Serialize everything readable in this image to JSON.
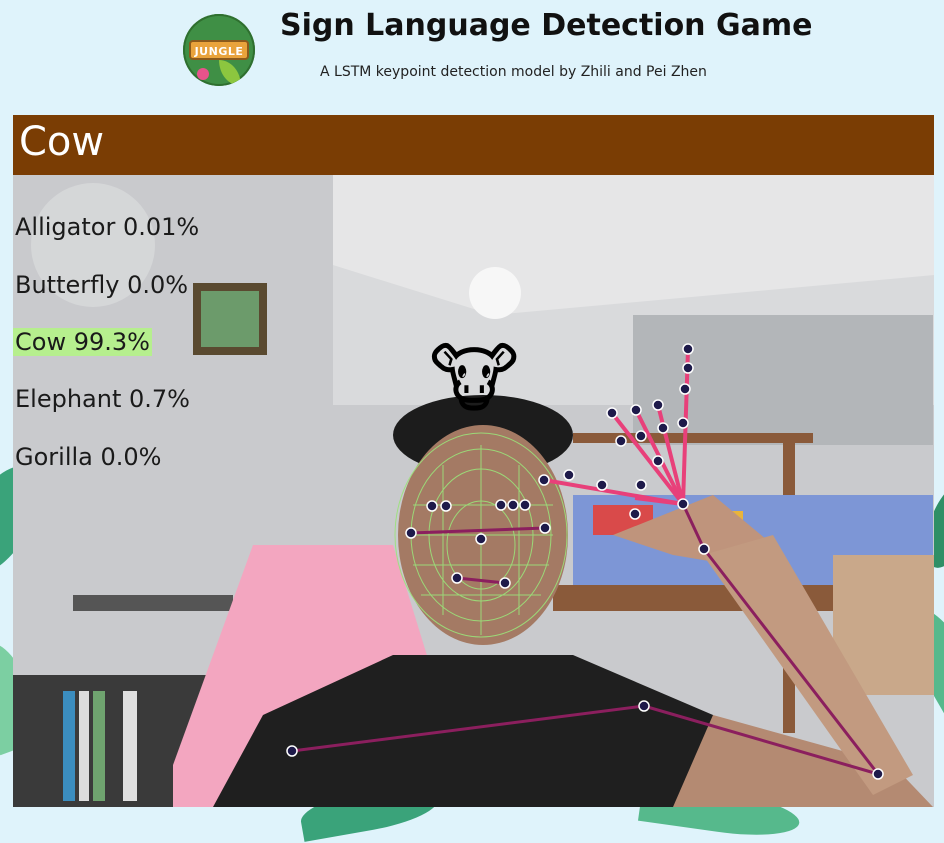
{
  "header": {
    "logo_text": "JUNGLE",
    "title": "Sign Language Detection Game",
    "subtitle": "A LSTM keypoint detection model by Zhili and Pei Zhen"
  },
  "game": {
    "target_word": "Cow",
    "target_emoji": "🐮",
    "predictions": [
      {
        "label": "Alligator 0.01%",
        "highlighted": false
      },
      {
        "label": "Butterfly 0.0%",
        "highlighted": false
      },
      {
        "label": "Cow 99.3%",
        "highlighted": true
      },
      {
        "label": "Elephant 0.7%",
        "highlighted": false
      },
      {
        "label": "Gorilla 0.0%",
        "highlighted": false
      }
    ]
  },
  "colors": {
    "page_bg": "#dff3fb",
    "banner": "#7a3d04",
    "highlight": "#b6ef8e",
    "pose_line": "#8b1f5e",
    "face_mesh": "#9be37a",
    "keypoint": "#1e1a4a",
    "hand_line": "#e8407a"
  }
}
